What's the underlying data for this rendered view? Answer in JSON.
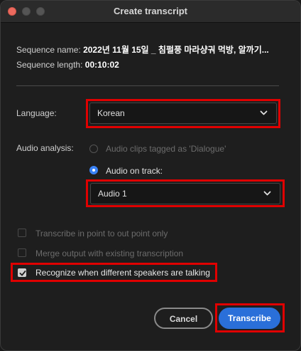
{
  "window": {
    "title": "Create transcript"
  },
  "sequence": {
    "name_label": "Sequence name:",
    "name_value": "2022년 11월 15일 _ 침펄풍 마라샹궈 먹방, 알까기...",
    "length_label": "Sequence length:",
    "length_value": "00:10:02"
  },
  "language": {
    "label": "Language:",
    "selected": "Korean"
  },
  "audio_analysis": {
    "label": "Audio analysis:",
    "option_dialogue": "Audio clips tagged as 'Dialogue'",
    "option_track": "Audio on track:",
    "selected_option": "track",
    "track_selected": "Audio 1"
  },
  "options": {
    "in_out_label": "Transcribe in point to out point only",
    "in_out_checked": false,
    "in_out_disabled": true,
    "merge_label": "Merge output with existing transcription",
    "merge_checked": false,
    "merge_disabled": true,
    "speakers_label": "Recognize when different speakers are talking",
    "speakers_checked": true
  },
  "buttons": {
    "cancel": "Cancel",
    "transcribe": "Transcribe"
  },
  "colors": {
    "accent": "#2a6fd9",
    "highlight": "#e00000",
    "radio_selected": "#3a82f6"
  },
  "icons": {
    "dropdown": "chevron-down-icon",
    "check": "checkmark-icon"
  }
}
